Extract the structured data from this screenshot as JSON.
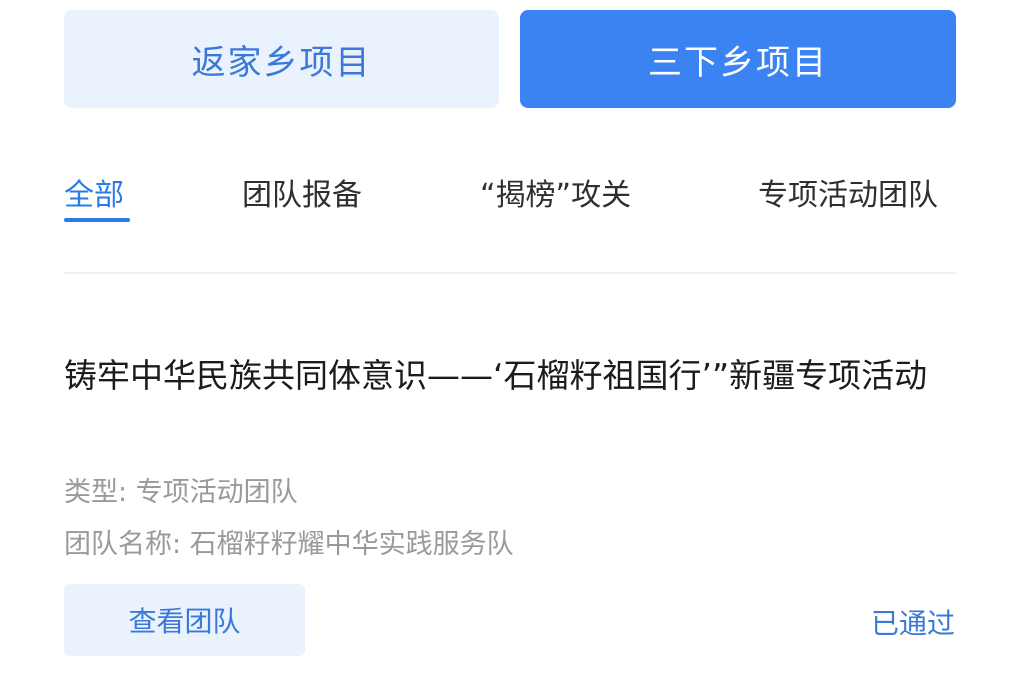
{
  "top_buttons": {
    "left_label": "返家乡项目",
    "right_label": "三下乡项目"
  },
  "tabs": [
    {
      "label": "全部",
      "active": true
    },
    {
      "label": "团队报备",
      "active": false
    },
    {
      "label": "“揭榜”攻关",
      "active": false
    },
    {
      "label": "专项活动团队",
      "active": false
    }
  ],
  "card": {
    "title": "铸牢中华民族共同体意识——‘石榴籽祖国行’”新疆专项活动",
    "type_label": "类型: 专项活动团队",
    "team_name_label": "团队名称: 石榴籽籽耀中华实践服务队",
    "view_button_label": "查看团队",
    "status": "已通过"
  },
  "colors": {
    "primary": "#3b82f2",
    "primary_light": "#eaf2fd",
    "tab_active": "#2a7ae8",
    "meta_text": "#9a9a9a"
  }
}
